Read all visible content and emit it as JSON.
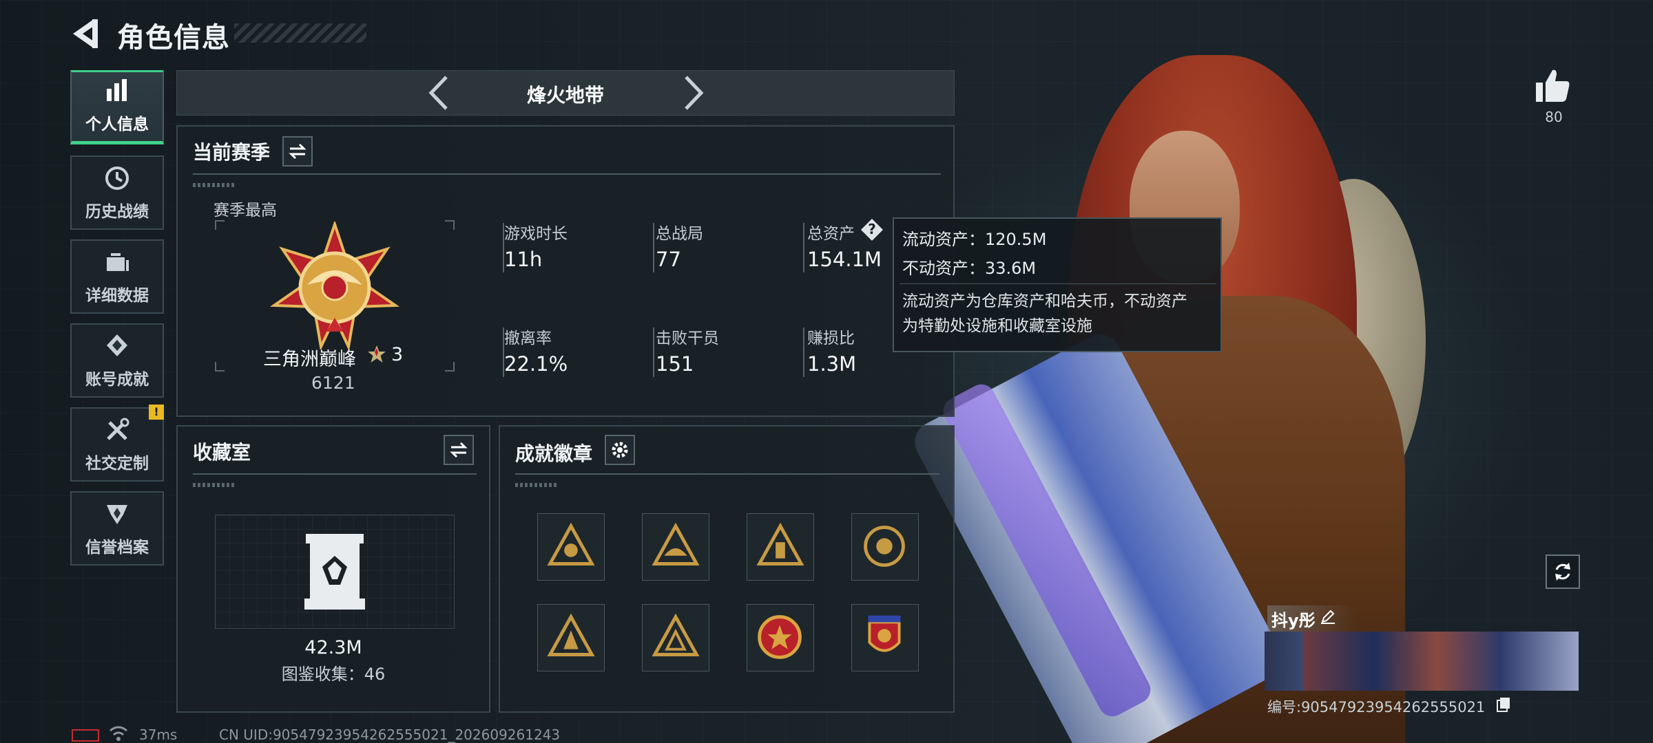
{
  "header": {
    "title": "角色信息"
  },
  "sidebar": {
    "items": [
      {
        "label": "个人信息",
        "icon": "bar-chart-icon",
        "active": true
      },
      {
        "label": "历史战绩",
        "icon": "history-icon"
      },
      {
        "label": "详细数据",
        "icon": "data-icon"
      },
      {
        "label": "账号成就",
        "icon": "achievement-icon"
      },
      {
        "label": "社交定制",
        "icon": "tools-icon",
        "badge": "!"
      },
      {
        "label": "信誉档案",
        "icon": "reputation-icon"
      }
    ]
  },
  "mode": {
    "name": "烽火地带"
  },
  "season": {
    "title": "当前赛季",
    "best_label": "赛季最高",
    "rank_name": "三角洲巅峰",
    "rank_stars": "3",
    "rank_score": "6121",
    "stats": [
      {
        "label": "游戏时长",
        "value": "11h"
      },
      {
        "label": "总战局",
        "value": "77"
      },
      {
        "label": "总资产",
        "value": "154.1M",
        "help": "?"
      },
      {
        "label": "撤离率",
        "value": "22.1%"
      },
      {
        "label": "击败干员",
        "value": "151"
      },
      {
        "label": "赚损比",
        "value": "1.3M"
      }
    ]
  },
  "tooltip": {
    "liquid": "流动资产：120.5M",
    "fixed": "不动资产：33.6M",
    "desc1": "流动资产为仓库资产和哈夫币，不动资产",
    "desc2": "为特勤处设施和收藏室设施"
  },
  "collection": {
    "title": "收藏室",
    "value": "42.3M",
    "count": "图鉴收集：46"
  },
  "achievements": {
    "title": "成就徽章",
    "badges": [
      "badge-1",
      "badge-2",
      "badge-3",
      "badge-4",
      "badge-5",
      "badge-6",
      "badge-7",
      "badge-8"
    ]
  },
  "likes": {
    "count": "80"
  },
  "nameplate": {
    "name": "抖y彤",
    "id": "编号:90547923954262555021"
  },
  "footer": {
    "ping": "37ms",
    "uid": "CN UID:90547923954262555021_202609261243"
  },
  "colors": {
    "accent": "#3fd08a",
    "gold": "#d9a441",
    "warn": "#e8b923"
  }
}
